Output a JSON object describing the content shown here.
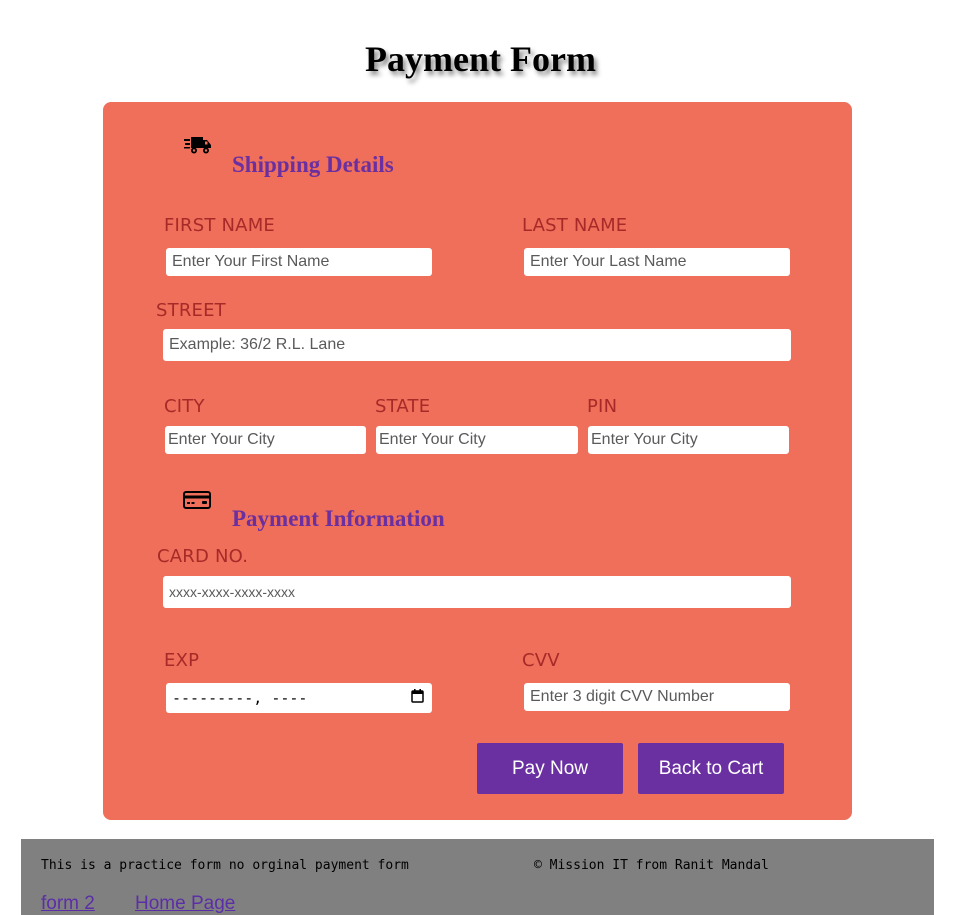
{
  "page": {
    "title": "Payment Form"
  },
  "shipping": {
    "icon": "truck-icon",
    "heading": "Shipping Details",
    "first_name": {
      "label": "FIRST NAME",
      "placeholder": "Enter Your First Name"
    },
    "last_name": {
      "label": "LAST NAME",
      "placeholder": "Enter Your Last Name"
    },
    "street": {
      "label": "STREET",
      "placeholder": "Example: 36/2 R.L. Lane"
    },
    "city": {
      "label": "CITY",
      "placeholder": "Enter Your City"
    },
    "state": {
      "label": "STATE",
      "placeholder": "Enter Your City"
    },
    "pin": {
      "label": "PIN",
      "placeholder": "Enter Your City"
    }
  },
  "payment": {
    "icon": "credit-card-icon",
    "heading": "Payment Information",
    "card_no": {
      "label": "CARD NO.",
      "placeholder": "xxxx-xxxx-xxxx-xxxx"
    },
    "exp": {
      "label": "EXP",
      "value": "---------, ----"
    },
    "cvv": {
      "label": "CVV",
      "placeholder": "Enter 3 digit CVV Number"
    }
  },
  "actions": {
    "pay_now": "Pay Now",
    "back_to_cart": "Back to Cart"
  },
  "footer": {
    "note": "This is a practice form no orginal payment form",
    "copyright": "© Mission IT from Ranit Mandal",
    "links": [
      "form 2",
      "Home Page"
    ]
  },
  "colors": {
    "card_background": "#ef6f5a",
    "heading_purple": "#6a2fa0",
    "label_red": "#a82a28",
    "button_purple": "#6a2fa0",
    "footer_gray": "#808080"
  }
}
